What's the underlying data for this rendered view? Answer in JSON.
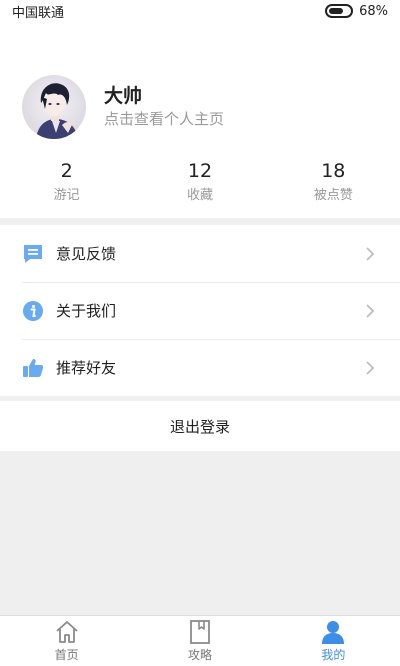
{
  "status_bar": {
    "carrier": "中国联通",
    "battery_percent": "68%",
    "battery_level": 0.68
  },
  "profile": {
    "name": "大帅",
    "subtitle": "点击查看个人主页"
  },
  "stats": [
    {
      "value": "2",
      "label": "游记"
    },
    {
      "value": "12",
      "label": "收藏"
    },
    {
      "value": "18",
      "label": "被点赞"
    }
  ],
  "menu": [
    {
      "label": "意见反馈",
      "icon": "feedback-icon"
    },
    {
      "label": "关于我们",
      "icon": "info-icon"
    },
    {
      "label": "推荐好友",
      "icon": "thumbs-up-icon"
    }
  ],
  "logout_label": "退出登录",
  "tabs": [
    {
      "label": "首页",
      "icon": "home-icon",
      "active": false
    },
    {
      "label": "攻略",
      "icon": "book-icon",
      "active": false
    },
    {
      "label": "我的",
      "icon": "user-icon",
      "active": true
    }
  ],
  "colors": {
    "accent": "#3d8ee6",
    "icon_blue": "#6aaaf0",
    "divider": "#f0f0f0"
  }
}
